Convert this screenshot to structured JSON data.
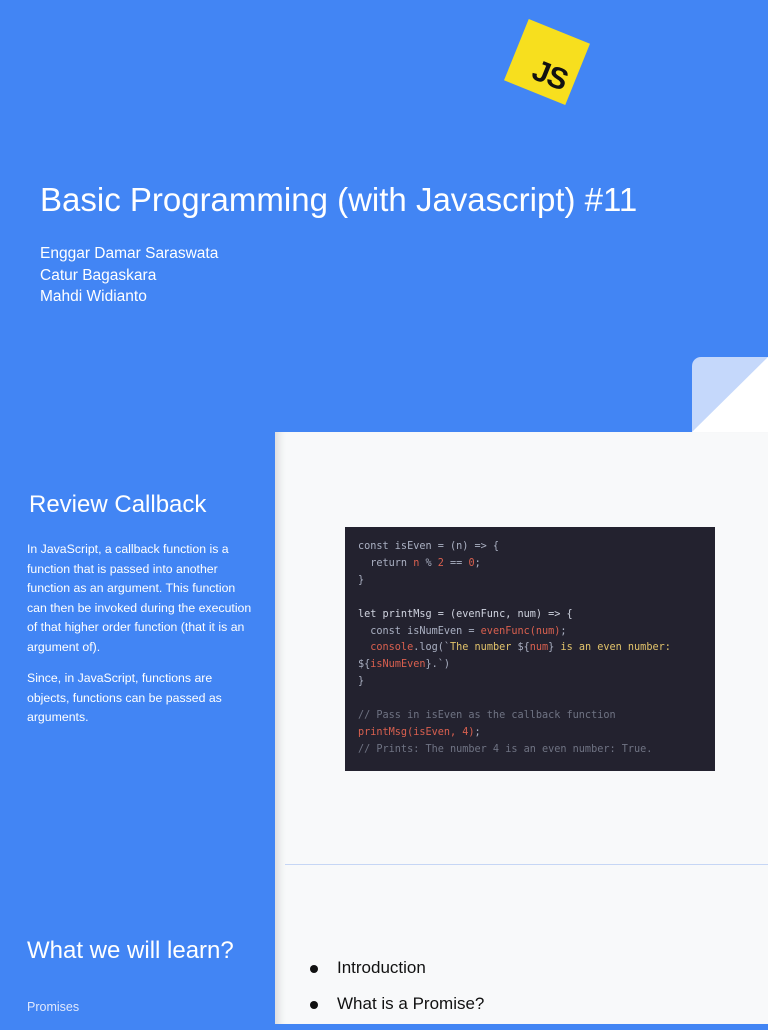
{
  "slide1": {
    "logo_text": "JS",
    "title": "Basic Programming (with Javascript) #11",
    "authors": [
      "Enggar Damar Saraswata",
      "Catur Bagaskara",
      "Mahdi Widianto"
    ]
  },
  "slide2": {
    "heading": "Review Callback",
    "paragraphs": [
      "In JavaScript, a callback function is a function that is passed into another function as an argument. This function can then be invoked during the execution of that higher order function (that it is an argument of).",
      "Since, in JavaScript, functions are objects, functions can be passed as arguments."
    ],
    "code_lines": [
      "const isEven = (n) => {",
      "  return n % 2 == 0;",
      "}",
      "",
      "let printMsg = (evenFunc, num) => {",
      "  const isNumEven = evenFunc(num);",
      "  console.log(`The number ${num} is an even number:",
      "${isNumEven}.`)",
      "}",
      "",
      "// Pass in isEven as the callback function",
      "printMsg(isEven, 4);",
      "// Prints: The number 4 is an even number: True."
    ]
  },
  "slide3": {
    "heading": "What we will learn?",
    "subtitle": "Promises",
    "bullets": [
      "Introduction",
      "What is a Promise?"
    ]
  },
  "colors": {
    "brand_blue": "#4285f4",
    "js_yellow": "#f7df1e",
    "code_bg": "#23222f"
  }
}
